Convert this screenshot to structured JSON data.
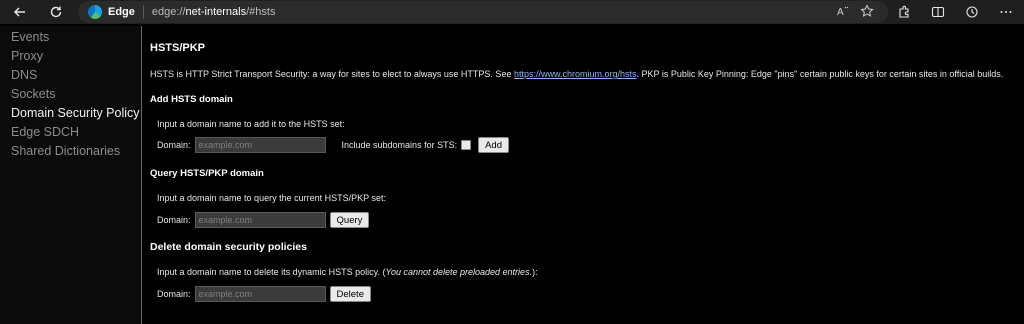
{
  "browser": {
    "brand": "Edge",
    "url_prefix": "edge://",
    "url_host": "net-internals",
    "url_path": "/#hsts",
    "icons": {
      "back": "back-arrow-icon",
      "refresh": "refresh-icon",
      "read_aloud": "read-aloud-icon",
      "favorite": "favorite-star-icon",
      "extensions": "extensions-icon",
      "split_screen": "split-screen-icon",
      "history": "history-icon",
      "more": "more-icon"
    }
  },
  "sidebar": {
    "items": [
      {
        "label": "Events"
      },
      {
        "label": "Proxy"
      },
      {
        "label": "DNS"
      },
      {
        "label": "Sockets"
      },
      {
        "label": "Domain Security Policy",
        "active": true
      },
      {
        "label": "Edge SDCH"
      },
      {
        "label": "Shared Dictionaries"
      }
    ]
  },
  "main": {
    "title": "HSTS/PKP",
    "desc_pre": "HSTS is HTTP Strict Transport Security: a way for sites to elect to always use HTTPS. See ",
    "desc_link": "https://www.chromium.org/hsts",
    "desc_post": ". PKP is Public Key Pinning: Edge \"pins\" certain public keys for certain sites in official builds.",
    "add": {
      "title": "Add HSTS domain",
      "instruction": "Input a domain name to add it to the HSTS set:",
      "domain_label": "Domain:",
      "placeholder": "example.com",
      "subdomains_label": "Include subdomains for STS:",
      "button": "Add"
    },
    "query": {
      "title": "Query HSTS/PKP domain",
      "instruction": "Input a domain name to query the current HSTS/PKP set:",
      "domain_label": "Domain:",
      "placeholder": "example.com",
      "button": "Query"
    },
    "delete": {
      "title": "Delete domain security policies",
      "instruction_pre": "Input a domain name to delete its dynamic HSTS policy. (",
      "instruction_em": "You cannot delete preloaded entries.",
      "instruction_post": "):",
      "domain_label": "Domain:",
      "placeholder": "example.com",
      "button": "Delete"
    }
  }
}
